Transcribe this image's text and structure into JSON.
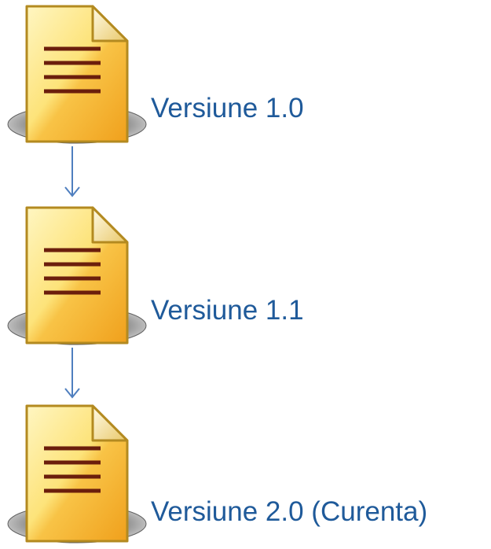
{
  "versions": [
    {
      "label": "Versiune 1.0",
      "icon": "document-icon"
    },
    {
      "label": "Versiune 1.1",
      "icon": "document-icon"
    },
    {
      "label": "Versiune 2.0 (Curenta)",
      "icon": "document-icon"
    }
  ],
  "connectors": [
    {
      "icon": "arrow-down-icon"
    },
    {
      "icon": "arrow-down-icon"
    }
  ],
  "colors": {
    "label_text": "#1f5a9a",
    "arrow": "#4f7fbf",
    "document_light": "#fff3b0",
    "document_dark": "#f2a21a",
    "document_border": "#b38a20",
    "document_lines": "#6b1e0c",
    "shadow": "#8a8a8a"
  }
}
